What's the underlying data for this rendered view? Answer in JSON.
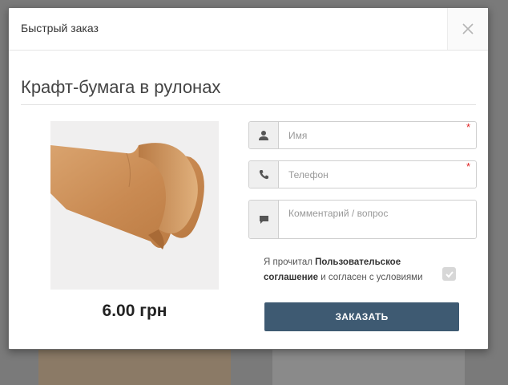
{
  "modal": {
    "title": "Быстрый заказ",
    "close_icon": "close-icon"
  },
  "product": {
    "name": "Крафт-бумага в рулонах",
    "price": "6.00 грн",
    "image_icon": "kraft-paper-roll-image"
  },
  "form": {
    "name_placeholder": "Имя",
    "phone_placeholder": "Телефон",
    "comment_placeholder": "Комментарий / вопрос",
    "required_mark": "*",
    "agreement": {
      "prefix": "Я прочитал ",
      "link": "Пользовательское соглашение",
      "suffix": " и согласен с условиями",
      "checked": true
    },
    "submit_label": "ЗАКАЗАТЬ"
  },
  "colors": {
    "accent": "#3e5a72",
    "required": "#e02020"
  }
}
